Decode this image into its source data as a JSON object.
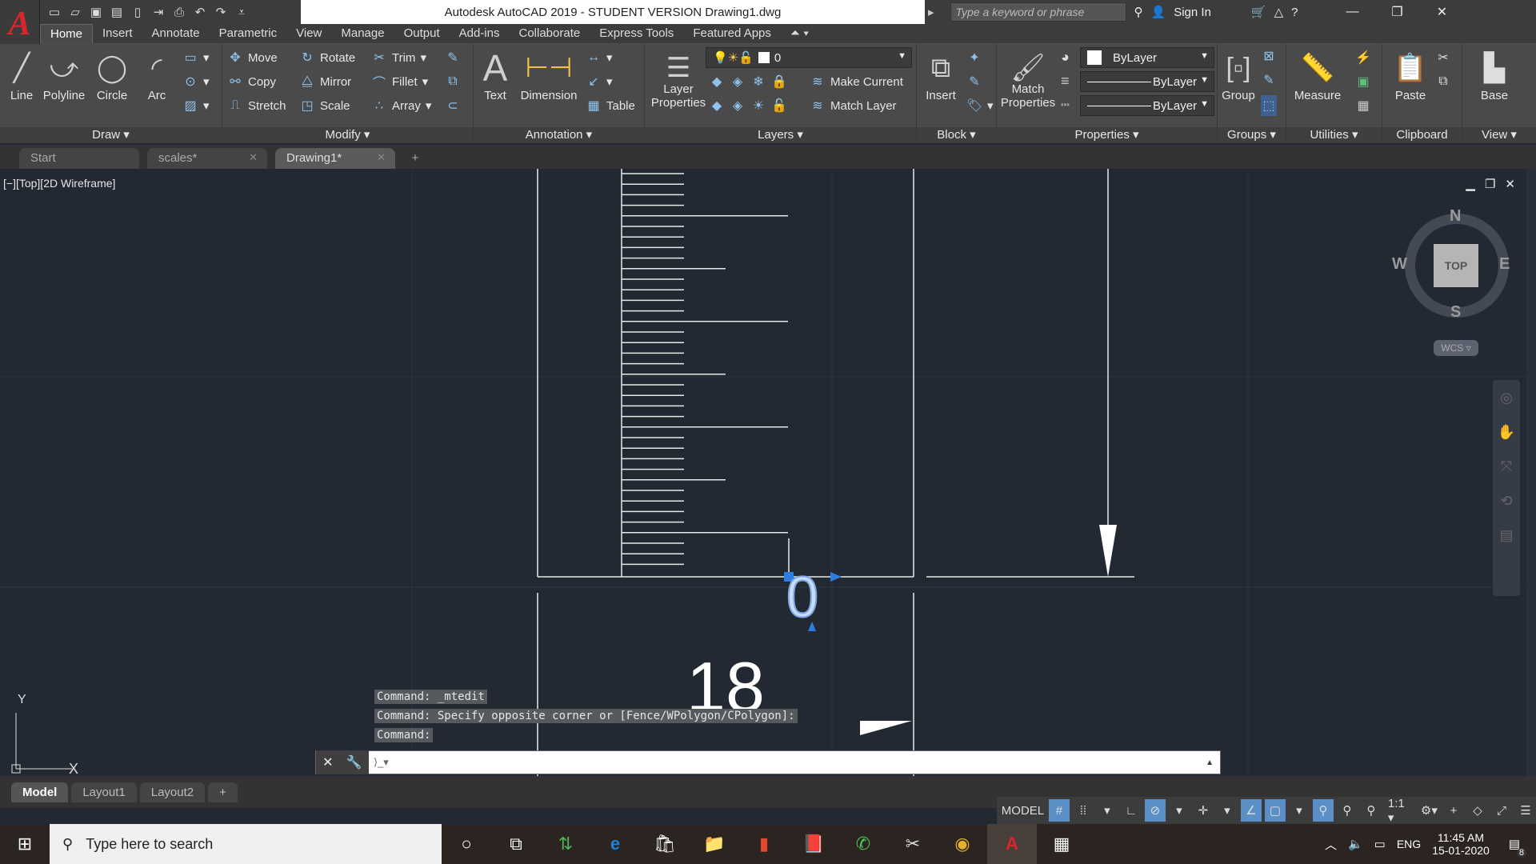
{
  "title_bar": {
    "app_title": "Autodesk AutoCAD 2019 - STUDENT VERSION    Drawing1.dwg",
    "search_placeholder": "Type a keyword or phrase",
    "sign_in": "Sign In",
    "minimize": "—",
    "restore": "❐",
    "close": "✕"
  },
  "ribbon_tabs": [
    "Home",
    "Insert",
    "Annotate",
    "Parametric",
    "View",
    "Manage",
    "Output",
    "Add-ins",
    "Collaborate",
    "Express Tools",
    "Featured Apps"
  ],
  "draw": {
    "line": "Line",
    "polyline": "Polyline",
    "circle": "Circle",
    "arc": "Arc",
    "title": "Draw ▾"
  },
  "modify": {
    "move": "Move",
    "rotate": "Rotate",
    "trim": "Trim",
    "copy": "Copy",
    "mirror": "Mirror",
    "fillet": "Fillet",
    "stretch": "Stretch",
    "scale": "Scale",
    "array": "Array",
    "title": "Modify ▾"
  },
  "annotation": {
    "text": "Text",
    "dimension": "Dimension",
    "table": "Table",
    "title": "Annotation ▾"
  },
  "layers": {
    "layer_properties": "Layer Properties",
    "current_layer": "0",
    "make_current": "Make Current",
    "match_layer": "Match Layer",
    "title": "Layers ▾"
  },
  "block": {
    "insert": "Insert",
    "title": "Block ▾"
  },
  "properties": {
    "match_properties": "Match Properties",
    "color": "ByLayer",
    "lineweight": "ByLayer",
    "linetype": "ByLayer",
    "title": "Properties ▾"
  },
  "groups": {
    "group": "Group",
    "title": "Groups ▾"
  },
  "utilities": {
    "measure": "Measure",
    "title": "Utilities ▾"
  },
  "clipboard": {
    "paste": "Paste",
    "title": "Clipboard"
  },
  "view": {
    "base": "Base",
    "title": "View ▾"
  },
  "doc_tabs": [
    {
      "label": "Start"
    },
    {
      "label": "scales*"
    },
    {
      "label": "Drawing1*"
    }
  ],
  "viewport": {
    "label": "[−][Top][2D Wireframe]",
    "text_0": "0",
    "text_18": "18"
  },
  "viewcube": {
    "n": "N",
    "s": "S",
    "e": "E",
    "w": "W",
    "face": "TOP",
    "ucs": "WCS ▿"
  },
  "ucs_icon": {
    "x": "X",
    "y": "Y"
  },
  "command_history": [
    "Command: _mtedit",
    "Command: Specify opposite corner or [Fence/WPolygon/CPolygon]:",
    "Command:"
  ],
  "command_input": {
    "value": "",
    "placeholder": ""
  },
  "layout_tabs": [
    "Model",
    "Layout1",
    "Layout2",
    "+"
  ],
  "status_bar": {
    "model": "MODEL",
    "scale": "1:1 ▾"
  },
  "taskbar": {
    "search_placeholder": "Type here to search",
    "time": "11:45 AM",
    "date": "15-01-2020",
    "lang": "ENG",
    "notifications": "8"
  }
}
